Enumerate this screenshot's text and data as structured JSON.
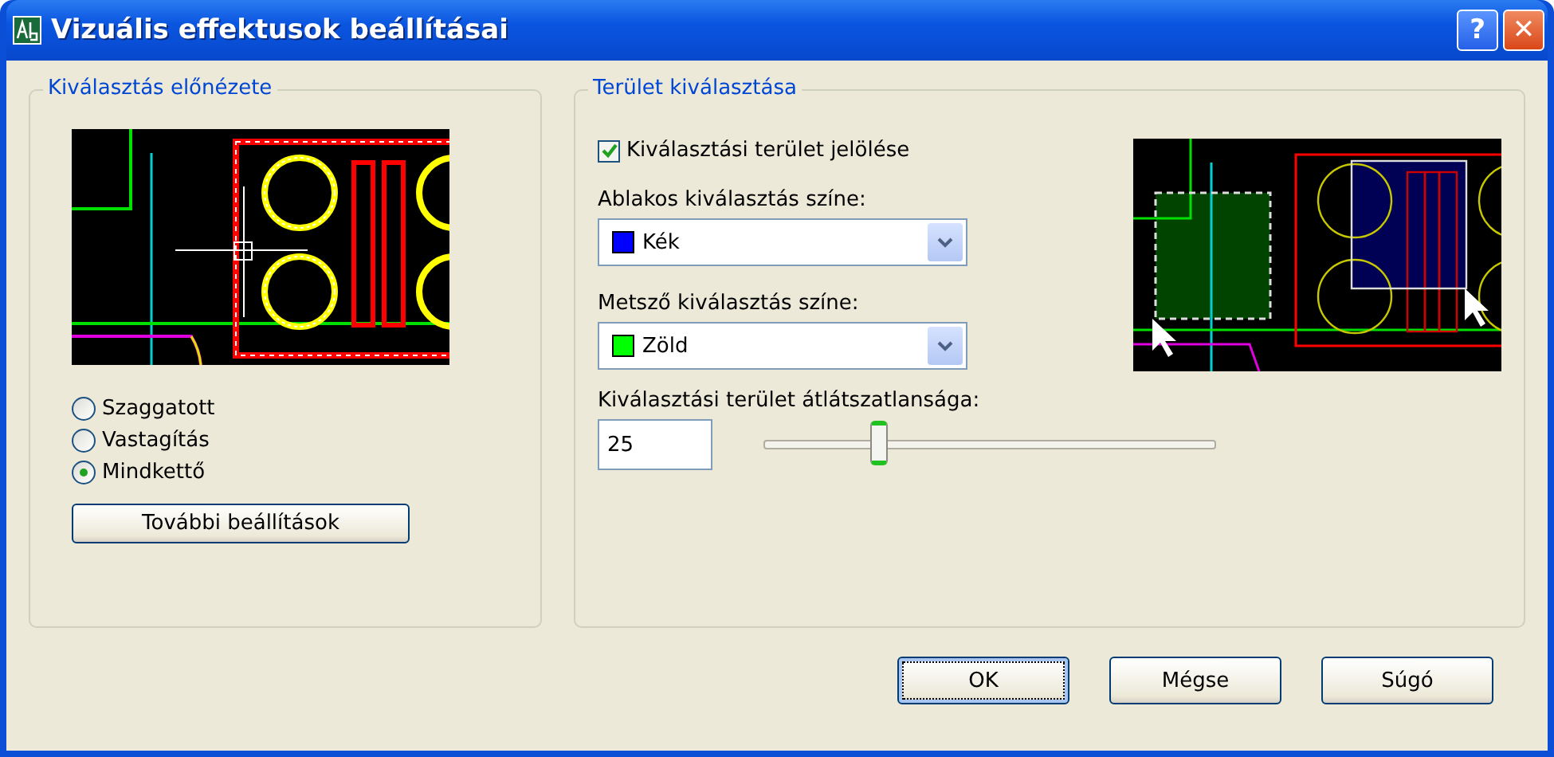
{
  "window": {
    "title": "Vizuális effektusok beállításai",
    "buttons": [
      {
        "kind": "help",
        "label": "?"
      },
      {
        "kind": "close",
        "label": "✕"
      }
    ]
  },
  "preview_group": {
    "title": "Kiválasztás előnézete",
    "options": [
      {
        "label": "Szaggatott",
        "selected": false
      },
      {
        "label": "Vastagítás",
        "selected": false
      },
      {
        "label": "Mindkettő",
        "selected": true
      }
    ],
    "button": "További beállítások"
  },
  "area_group": {
    "title": "Terület kiválasztása",
    "checkbox": {
      "label": "Kiválasztási terület jelölése",
      "checked": true
    },
    "window_color": {
      "label": "Ablakos kiválasztás színe:",
      "value": "Kék",
      "color": "#0000ff"
    },
    "crossing_color": {
      "label": "Metsző kiválasztás színe:",
      "value": "Zöld",
      "color": "#00ff00"
    },
    "opacity": {
      "label": "Kiválasztási terület átlátszatlansága:",
      "value": "25",
      "level": 0.25
    }
  },
  "buttons": [
    {
      "label": "OK",
      "focused": true
    },
    {
      "label": "Mégse",
      "focused": false
    },
    {
      "label": "Súgó",
      "focused": false
    }
  ]
}
